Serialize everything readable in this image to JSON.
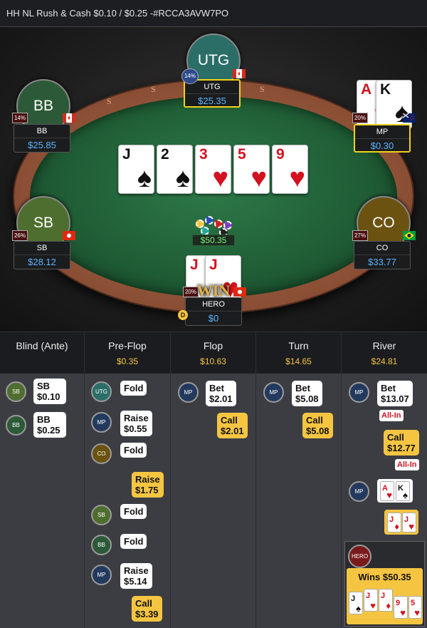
{
  "title": "HH NL Rush & Cash $0.10 / $0.25 -#RCCA3AVW7PO",
  "rail_letters": [
    "S",
    "S",
    "S",
    "S",
    "S",
    "S",
    "S"
  ],
  "board": [
    {
      "rank": "J",
      "suit": "♠",
      "color": "black"
    },
    {
      "rank": "2",
      "suit": "♠",
      "color": "black"
    },
    {
      "rank": "3",
      "suit": "♥",
      "color": "red"
    },
    {
      "rank": "5",
      "suit": "♥",
      "color": "red"
    },
    {
      "rank": "9",
      "suit": "♥",
      "color": "red"
    }
  ],
  "pot": "$50.35",
  "players": {
    "utg": {
      "avatar": "UTG",
      "name": "UTG",
      "stack": "$25.35",
      "pct": "14%",
      "flag": "canada",
      "active": true
    },
    "bb": {
      "avatar": "BB",
      "name": "BB",
      "stack": "$25.85",
      "pct": "14%",
      "flag": "canada"
    },
    "mp": {
      "name": "MP",
      "stack": "$0.30",
      "pct": "20%",
      "flag": "new-zealand",
      "active": true,
      "cards": [
        {
          "rank": "A",
          "suit": "♥",
          "color": "red"
        },
        {
          "rank": "K",
          "suit": "♠",
          "color": "black"
        }
      ]
    },
    "sb": {
      "avatar": "SB",
      "name": "SB",
      "stack": "$28.12",
      "pct": "26%",
      "flag": "hong-kong"
    },
    "co": {
      "avatar": "CO",
      "name": "CO",
      "stack": "$33.77",
      "pct": "27%",
      "flag": "brazil"
    },
    "hero": {
      "name": "HERO",
      "stack": "$0",
      "pct": "20%",
      "flag": "hong-kong",
      "win": "WIN",
      "dealer": "D",
      "cards": [
        {
          "rank": "J",
          "suit": "♦",
          "color": "red"
        },
        {
          "rank": "J",
          "suit": "♥",
          "color": "red"
        }
      ]
    }
  },
  "streets": [
    {
      "name": "Blind (Ante)",
      "pot": ""
    },
    {
      "name": "Pre-Flop",
      "pot": "$0.35"
    },
    {
      "name": "Flop",
      "pot": "$10.63"
    },
    {
      "name": "Turn",
      "pot": "$14.65"
    },
    {
      "name": "River",
      "pot": "$24.81"
    }
  ],
  "actions": {
    "blind": [
      {
        "pos": "SB",
        "l1": "SB",
        "l2": "$0.10"
      },
      {
        "pos": "BB",
        "l1": "BB",
        "l2": "$0.25"
      }
    ],
    "preflop": [
      {
        "pos": "UTG",
        "l1": "Fold"
      },
      {
        "pos": "MP",
        "l1": "Raise",
        "l2": "$0.55"
      },
      {
        "pos": "CO",
        "l1": "Fold"
      },
      {
        "hero": true,
        "l1": "Raise",
        "l2": "$1.75"
      },
      {
        "pos": "SB",
        "l1": "Fold"
      },
      {
        "pos": "BB",
        "l1": "Fold"
      },
      {
        "pos": "MP",
        "l1": "Raise",
        "l2": "$5.14"
      },
      {
        "hero": true,
        "l1": "Call",
        "l2": "$3.39"
      }
    ],
    "flop": [
      {
        "pos": "MP",
        "l1": "Bet",
        "l2": "$2.01"
      },
      {
        "hero": true,
        "l1": "Call",
        "l2": "$2.01"
      }
    ],
    "turn": [
      {
        "pos": "MP",
        "l1": "Bet",
        "l2": "$5.08"
      },
      {
        "hero": true,
        "l1": "Call",
        "l2": "$5.08"
      }
    ],
    "river": [
      {
        "pos": "MP",
        "l1": "Bet",
        "l2": "$13.07",
        "tag": "All-In"
      },
      {
        "hero": true,
        "l1": "Call",
        "l2": "$12.77",
        "tag": "All-In"
      }
    ]
  },
  "showdown": {
    "mp_label": "MP",
    "mp_cards": [
      {
        "rank": "A",
        "suit": "♥",
        "color": "red"
      },
      {
        "rank": "K",
        "suit": "♠",
        "color": "black"
      }
    ],
    "hero_cards": [
      {
        "rank": "J",
        "suit": "♦",
        "color": "red"
      },
      {
        "rank": "J",
        "suit": "♥",
        "color": "red"
      }
    ],
    "hero_label": "HERO",
    "wins": "Wins $50.35",
    "best_hand": [
      {
        "rank": "J",
        "suit": "♠",
        "color": "black"
      },
      {
        "rank": "J",
        "suit": "♥",
        "color": "red"
      },
      {
        "rank": "J",
        "suit": "♦",
        "color": "red"
      },
      {
        "rank": "9",
        "suit": "♥",
        "color": "red"
      },
      {
        "rank": "5",
        "suit": "♥",
        "color": "red"
      }
    ]
  },
  "colors": {
    "utg": "#2b6e68",
    "bb": "#2c5a38",
    "sb": "#4e6e2f",
    "co": "#6b5210",
    "mp": "#233a5e",
    "hero": "#7a1b1b",
    "pot_text": "#7af07a",
    "stack_text": "#5bb4ff",
    "highlight": "#f0d21c"
  }
}
